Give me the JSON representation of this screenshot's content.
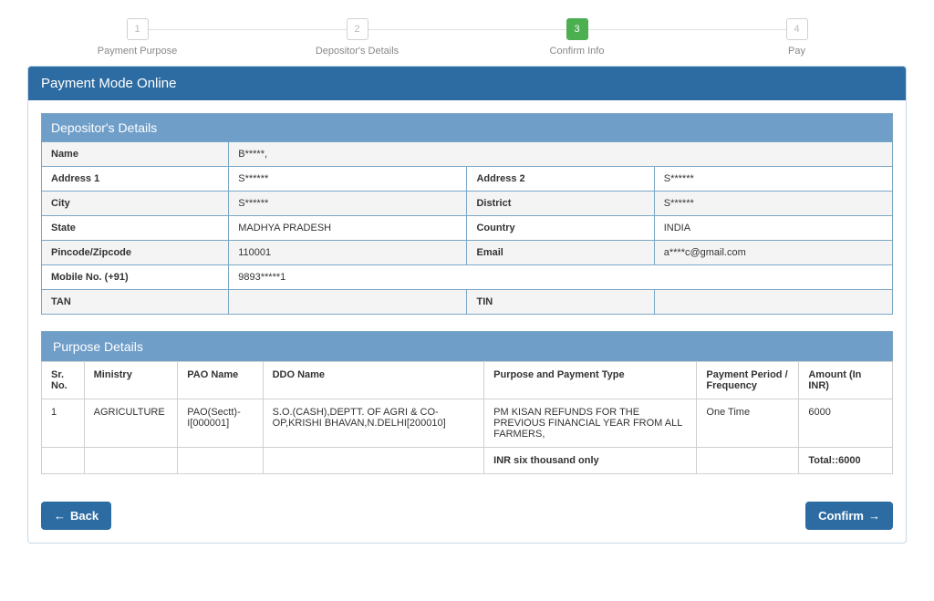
{
  "steps": [
    {
      "num": "1",
      "label": "Payment Purpose"
    },
    {
      "num": "2",
      "label": "Depositor's Details"
    },
    {
      "num": "3",
      "label": "Confirm Info"
    },
    {
      "num": "4",
      "label": "Pay"
    }
  ],
  "active_step": 3,
  "panel_title": "Payment Mode Online",
  "depositor": {
    "section_title": "Depositor's Details",
    "labels": {
      "name": "Name",
      "address1": "Address 1",
      "address2": "Address 2",
      "city": "City",
      "district": "District",
      "state": "State",
      "country": "Country",
      "pincode": "Pincode/Zipcode",
      "email": "Email",
      "mobile": "Mobile No. (+91)",
      "tan": "TAN",
      "tin": "TIN"
    },
    "values": {
      "name": "B*****,",
      "address1": "S******",
      "address2": "S******",
      "city": "S******",
      "district": "S******",
      "state": "MADHYA PRADESH",
      "country": "INDIA",
      "pincode": "110001",
      "email": "a****c@gmail.com",
      "mobile": "9893*****1",
      "tan": "",
      "tin": ""
    }
  },
  "purpose": {
    "section_title": "Purpose Details",
    "headers": {
      "srno": "Sr. No.",
      "ministry": "Ministry",
      "pao": "PAO Name",
      "ddo": "DDO Name",
      "purpose": "Purpose and Payment Type",
      "period": "Payment Period / Frequency",
      "amount": "Amount (In INR)"
    },
    "rows": [
      {
        "srno": "1",
        "ministry": "AGRICULTURE",
        "pao": "PAO(Sectt)-I[000001]",
        "ddo": "S.O.(CASH),DEPTT. OF AGRI & CO-OP,KRISHI BHAVAN,N.DELHI[200010]",
        "purpose": "PM KISAN REFUNDS FOR THE PREVIOUS FINANCIAL YEAR FROM ALL FARMERS,",
        "period": "One Time",
        "amount": "6000"
      }
    ],
    "amount_words": "INR six thousand only",
    "total_label": "Total::6000"
  },
  "buttons": {
    "back": "Back",
    "confirm": "Confirm"
  }
}
